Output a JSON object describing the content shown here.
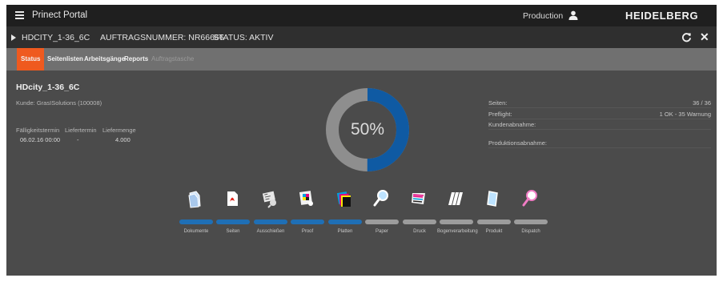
{
  "header": {
    "app_title": "Prinect Portal",
    "user_label": "Production",
    "logo_text": "HEIDELBERG"
  },
  "job": {
    "name": "HDCITY_1-36_6C",
    "number": "AUFTRAGSNUMMER: NR66666",
    "status": "STATUS: AKTIV"
  },
  "tabs": [
    {
      "label": "Status",
      "state": "active"
    },
    {
      "label": "Seitenlisten",
      "state": "enabled"
    },
    {
      "label": "Arbeitsgänge",
      "state": "enabled"
    },
    {
      "label": "Reports",
      "state": "enabled"
    },
    {
      "label": "Auftragstasche",
      "state": "disabled"
    }
  ],
  "details": {
    "title": "HDcity_1-36_6C",
    "customer": "Kunde: GrasISolutions (100008)",
    "labels": [
      "Fälligkeitstermin",
      "Liefertermin",
      "Liefermenge"
    ],
    "values": [
      "06.02.16 00:00",
      "-",
      "4.000"
    ]
  },
  "progress": {
    "percent_label": "50%",
    "fraction": 0.5,
    "fill_color": "#0f5aa3",
    "track_color": "#8e8e8e"
  },
  "stats": [
    {
      "label": "Seiten:",
      "value": "36 / 36"
    },
    {
      "label": "Preflight:",
      "value": "1 OK - 35 Warnung"
    },
    {
      "label": "Kundenabnahme:",
      "value": ""
    },
    {
      "label": "Produktionsabnahme:",
      "value": ""
    }
  ],
  "steps": [
    {
      "label": "Dokumente",
      "icon": "document-icon",
      "done": true
    },
    {
      "label": "Seiten",
      "icon": "pdf-page-icon",
      "done": true
    },
    {
      "label": "Ausschießen",
      "icon": "imposition-icon",
      "done": true
    },
    {
      "label": "Proof",
      "icon": "proof-icon",
      "done": true
    },
    {
      "label": "Platten",
      "icon": "plates-icon",
      "done": true
    },
    {
      "label": "Paper",
      "icon": "paper-magnifier-icon",
      "done": false
    },
    {
      "label": "Druck",
      "icon": "press-icon",
      "done": false
    },
    {
      "label": "Bogenverarbeitung",
      "icon": "sheet-processing-icon",
      "done": false
    },
    {
      "label": "Produkt",
      "icon": "product-icon",
      "done": false
    },
    {
      "label": "Dispatch",
      "icon": "dispatch-magnifier-icon",
      "done": false
    }
  ],
  "colors": {
    "accent": "#ef5a1f",
    "step_done": "#1f6fb5",
    "step_pending": "#9c9c9c"
  }
}
